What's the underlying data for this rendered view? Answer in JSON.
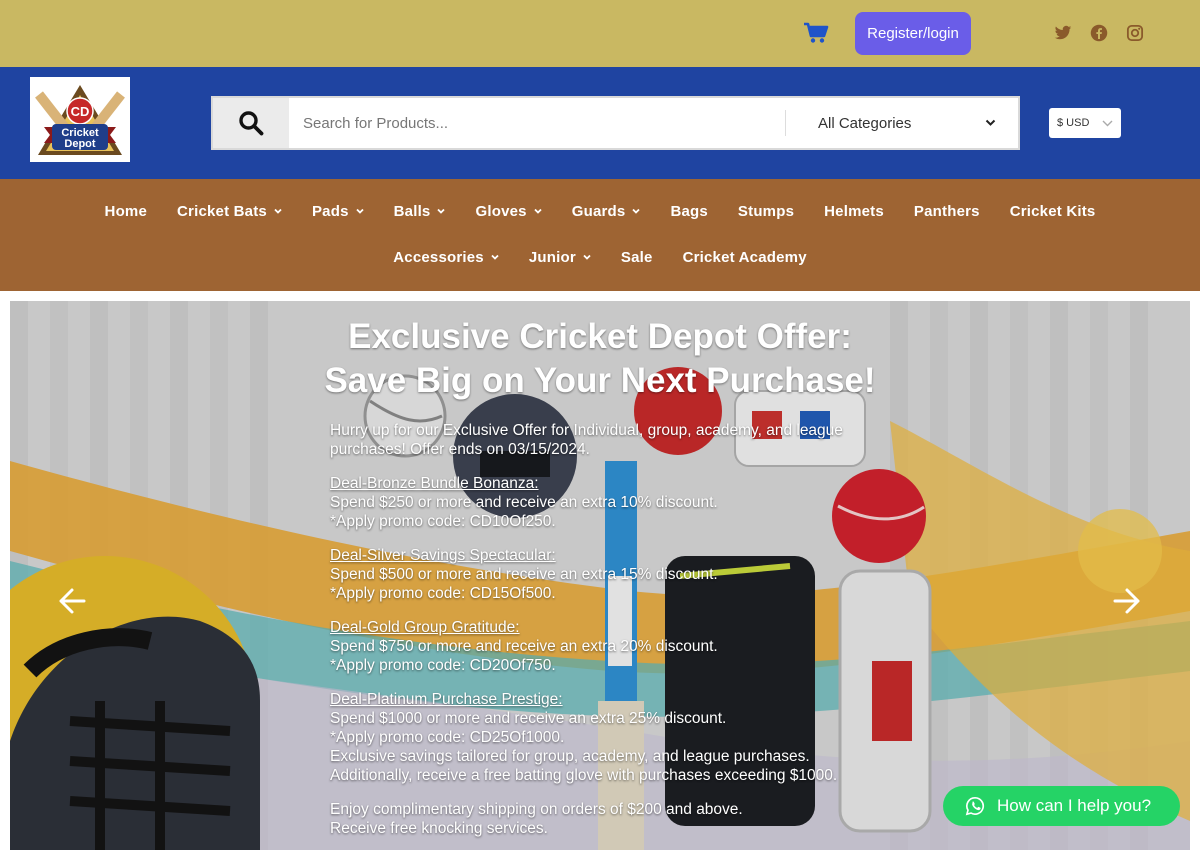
{
  "topbar": {
    "register_label": "Register/login",
    "icons": [
      "cart-icon",
      "twitter-icon",
      "facebook-icon",
      "instagram-icon"
    ]
  },
  "header": {
    "logo_text": "CD",
    "logo_sub1": "Cricket",
    "logo_sub2": "Depot",
    "search_placeholder": "Search for Products...",
    "category_selected": "All Categories",
    "currency": "$ USD"
  },
  "nav": {
    "row1": [
      {
        "label": "Home",
        "dropdown": false
      },
      {
        "label": "Cricket Bats",
        "dropdown": true
      },
      {
        "label": "Pads",
        "dropdown": true
      },
      {
        "label": "Balls",
        "dropdown": true
      },
      {
        "label": "Gloves",
        "dropdown": true
      },
      {
        "label": "Guards",
        "dropdown": true
      },
      {
        "label": "Bags",
        "dropdown": false
      },
      {
        "label": "Stumps",
        "dropdown": false
      },
      {
        "label": "Helmets",
        "dropdown": false
      },
      {
        "label": "Panthers",
        "dropdown": false
      },
      {
        "label": "Cricket Kits",
        "dropdown": false
      }
    ],
    "row2": [
      {
        "label": "Accessories",
        "dropdown": true
      },
      {
        "label": "Junior",
        "dropdown": true
      },
      {
        "label": "Sale",
        "dropdown": false
      },
      {
        "label": "Cricket Academy",
        "dropdown": false
      }
    ]
  },
  "hero": {
    "title_line1": "Exclusive Cricket Depot Offer:",
    "title_line2": "Save Big on Your Next Purchase!",
    "intro": "Hurry up for our Exclusive Offer for Individual, group, academy, and league purchases! Offer ends on 03/15/2024.",
    "deals": [
      {
        "name": "Deal-Bronze Bundle Bonanza:",
        "desc": "Spend $250 or more and receive an extra 10% discount.",
        "code": "*Apply promo code: CD10Of250."
      },
      {
        "name": "Deal-Silver Savings Spectacular:",
        "desc": "Spend $500 or more and receive an extra 15% discount.",
        "code": "*Apply promo code: CD15Of500."
      },
      {
        "name": "Deal-Gold Group Gratitude:",
        "desc": "Spend $750 or more and receive an extra 20% discount.",
        "code": "*Apply promo code: CD20Of750."
      },
      {
        "name": "Deal-Platinum Purchase Prestige:",
        "desc": "Spend $1000 or more and receive an extra 25% discount.",
        "code": "*Apply promo code: CD25Of1000."
      }
    ],
    "platinum_extra1": "Exclusive savings tailored for group, academy, and league purchases.",
    "platinum_extra2": "Additionally, receive a free batting glove with purchases exceeding $1000.",
    "shipping1": "Enjoy complimentary shipping on orders of $200 and above.",
    "shipping2": "Receive free knocking services."
  },
  "whatsapp": {
    "label": "How can I help you?"
  },
  "colors": {
    "topbar": "#c9b862",
    "header": "#1f44a1",
    "nav": "#9e6433",
    "register": "#6a5de8",
    "whatsapp": "#25d366"
  }
}
